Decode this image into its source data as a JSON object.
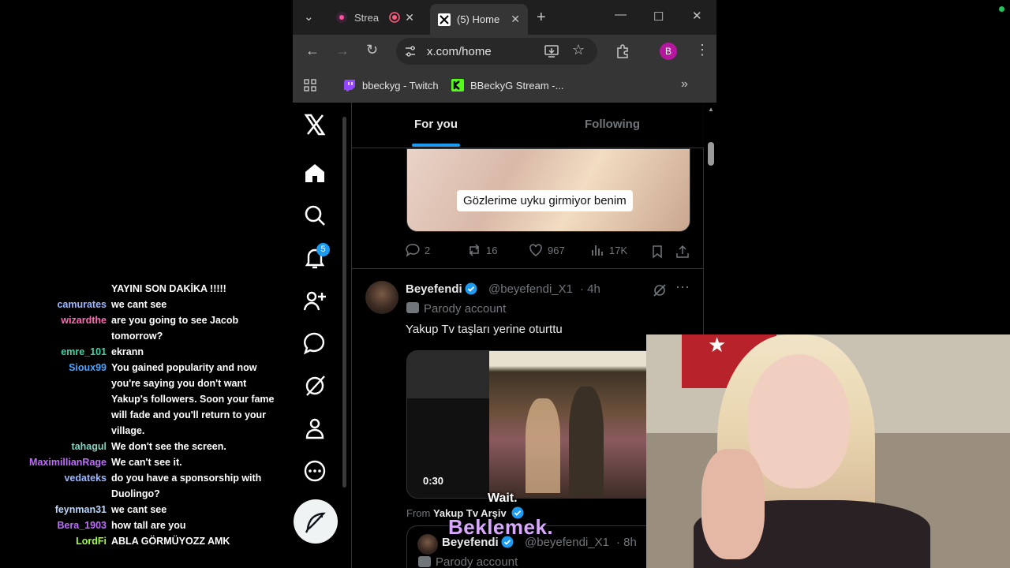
{
  "chat": {
    "lines": [
      {
        "user": "",
        "color": "#ffffff",
        "msg": "YAYINI SON DAKİKA !!!!!"
      },
      {
        "user": "camurates",
        "color": "#9ab8ff",
        "msg": "we cant see"
      },
      {
        "user": "wizardthe",
        "color": "#ff69b4",
        "msg": "are you going to see Jacob tomorrow?"
      },
      {
        "user": "emre_101",
        "color": "#3fd4a8",
        "msg": "ekrann"
      },
      {
        "user": "Sioux99",
        "color": "#4aa3ff",
        "msg": "You gained popularity and now you're saying you don't want Yakup's followers. Soon your fame will fade and you'll return to your village."
      },
      {
        "user": "tahagul",
        "color": "#7fd3c2",
        "msg": "We don't see the screen."
      },
      {
        "user": "MaximillianRage",
        "color": "#c06cff",
        "msg": "We can't see it."
      },
      {
        "user": "vedateks",
        "color": "#9ab8ff",
        "msg": "do you have a sponsorship with Duolingo?"
      },
      {
        "user": "feynman31",
        "color": "#b8d7ff",
        "msg": "we cant see"
      },
      {
        "user": "Bera_1903",
        "color": "#c06cff",
        "msg": "how tall are you"
      },
      {
        "user": "LordFi",
        "color": "#9cff3b",
        "msg": "ABLA GÖRMÜYOZZ AMK"
      }
    ]
  },
  "browser": {
    "tabs": [
      {
        "label": "Strea",
        "active": false
      },
      {
        "label": "(5) Home",
        "active": true
      }
    ],
    "url": "x.com/home",
    "profile_initial": "B",
    "bookmarks": [
      {
        "label": "bbeckyg - Twitch"
      },
      {
        "label": "BBeckyG Stream -..."
      }
    ]
  },
  "x": {
    "nav": {
      "notification_count": "5"
    },
    "feed_tabs": {
      "for_you": "For you",
      "following": "Following"
    },
    "tweet1": {
      "caption": "Gözlerime uyku girmiyor benim",
      "replies": "2",
      "retweets": "16",
      "likes": "967",
      "views": "17K"
    },
    "tweet2": {
      "name": "Beyefendi",
      "handle": "@beyefendi_X1",
      "time": "· 4h",
      "label": "Parody account",
      "text": "Yakup Tv taşları yerine oturttu",
      "duration": "0:30",
      "from_label": "From",
      "from_name": "Yakup Tv Arşiv",
      "quoted_name": "Beyefendi",
      "quoted_handle": "@beyefendi_X1",
      "quoted_time": "· 8h",
      "quoted_label": "Parody account"
    }
  },
  "subtitles": {
    "english": "Wait.",
    "turkish": "Beklemek."
  }
}
